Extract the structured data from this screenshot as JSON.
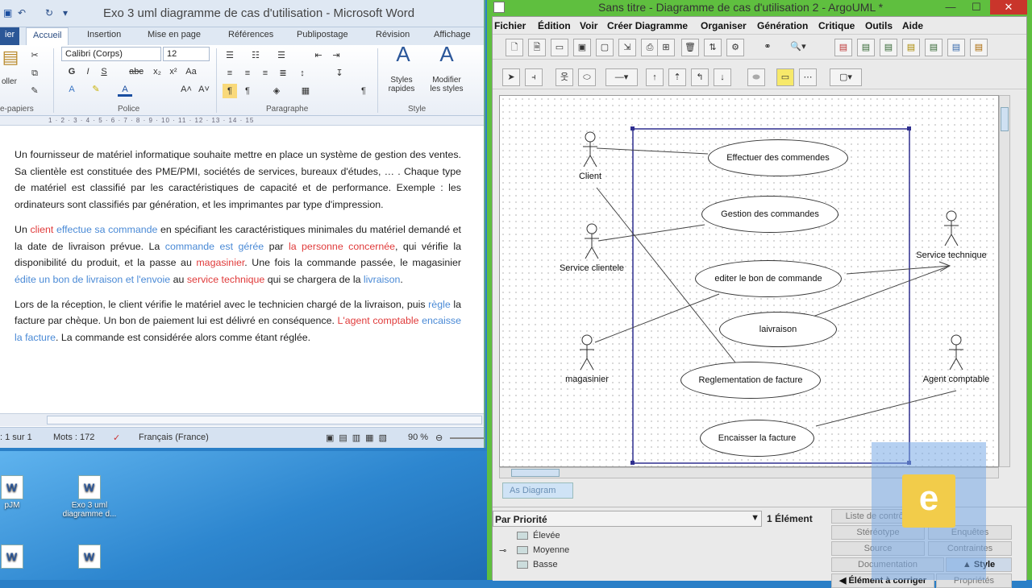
{
  "word": {
    "title": "Exo 3 uml diagramme de cas d'utilisation - Microsoft Word",
    "file_tab": "ier",
    "tabs": [
      "Accueil",
      "Insertion",
      "Mise en page",
      "Références",
      "Publipostage",
      "Révision",
      "Affichage"
    ],
    "font_name": "Calibri (Corps)",
    "font_size": "12",
    "group_clipboard": "e-papiers",
    "group_police": "Police",
    "group_paragraphe": "Paragraphe",
    "group_style": "Style",
    "paste_label": "oller",
    "styles_rapides": "Styles\nrapides",
    "modifier_styles": "Modifier\nles styles",
    "ruler_numbers": "1 · 2 · 3 · 4 · 5 · 6 · 7 · 8 · 9 · 10 · 11 · 12 · 13 · 14 · 15",
    "para1": "Un fournisseur de matériel informatique souhaite mettre en place un système de gestion des ventes. Sa clientèle est constituée des PME/PMI, sociétés de services, bureaux d'études, … . Chaque type de matériel est classifié par les caractéristiques de capacité et de performance. Exemple : les ordinateurs sont classifiés par génération, et les imprimantes par type d'impression.",
    "p2": {
      "a": "Un ",
      "client": "client",
      "b": " ",
      "effectue": "effectue sa commande",
      "c": " en spécifiant les caractéristiques minimales du matériel demandé et la date de livraison prévue. La ",
      "geree": "commande est gérée",
      "d": " par ",
      "personne": "la personne concernée",
      "e": ", qui vérifie la disponibilité du produit, et la passe au ",
      "magasinier": "magasinier",
      "f": ". Une fois la commande passée, le magasinier ",
      "edite": "édite un bon de livraison et l'envoie",
      "g": " au ",
      "service": "service technique",
      "h": " qui se chargera de la ",
      "livraison": "livraison",
      "i": "."
    },
    "p3": {
      "a": "Lors de la réception, le client vérifie le matériel avec le technicien chargé de la livraison, puis ",
      "regle": "règle",
      "b": " la facture par chèque. Un bon de paiement lui est délivré en conséquence. ",
      "agent": "L'agent comptable",
      "c": " ",
      "encaisse": "encaisse la facture",
      "d": ". La commande est considérée alors comme étant réglée."
    },
    "status_page": ": 1 sur 1",
    "status_words": "Mots : 172",
    "status_lang": "Français (France)",
    "zoom": "90 %"
  },
  "desktop": {
    "icons": [
      "",
      "",
      "pJM",
      "Exo 3 uml\ndiagramme d...",
      "",
      "",
      ""
    ]
  },
  "argo": {
    "title": "Sans titre - Diagramme de cas d'utilisation 2 - ArgoUML *",
    "menu": [
      "Fichier",
      "Édition",
      "Voir",
      "Créer Diagramme",
      "Organiser",
      "Génération",
      "Critique",
      "Outils",
      "Aide"
    ],
    "actors": [
      "Client",
      "Service clientele",
      "magasinier",
      "Service technique",
      "Agent comptable"
    ],
    "usecases": [
      "Effectuer des commendes",
      "Gestion des commandes",
      "editer le bon de commande",
      "laivraison",
      "Reglementation de facture",
      "Encaisser la facture"
    ],
    "diagram_tab": "As Diagram",
    "todo_sort": "Par Priorité",
    "todo_count": "1 Élément",
    "tree": [
      "Élevée",
      "Moyenne",
      "Basse"
    ],
    "prop_tabs": [
      "Liste de contrôle",
      "Stéréotype",
      "Enquêtes",
      "Source",
      "Contraintes",
      "Documentation",
      "Style",
      "Élément à corriger",
      "Propriétés"
    ]
  },
  "logo_letter": "e"
}
